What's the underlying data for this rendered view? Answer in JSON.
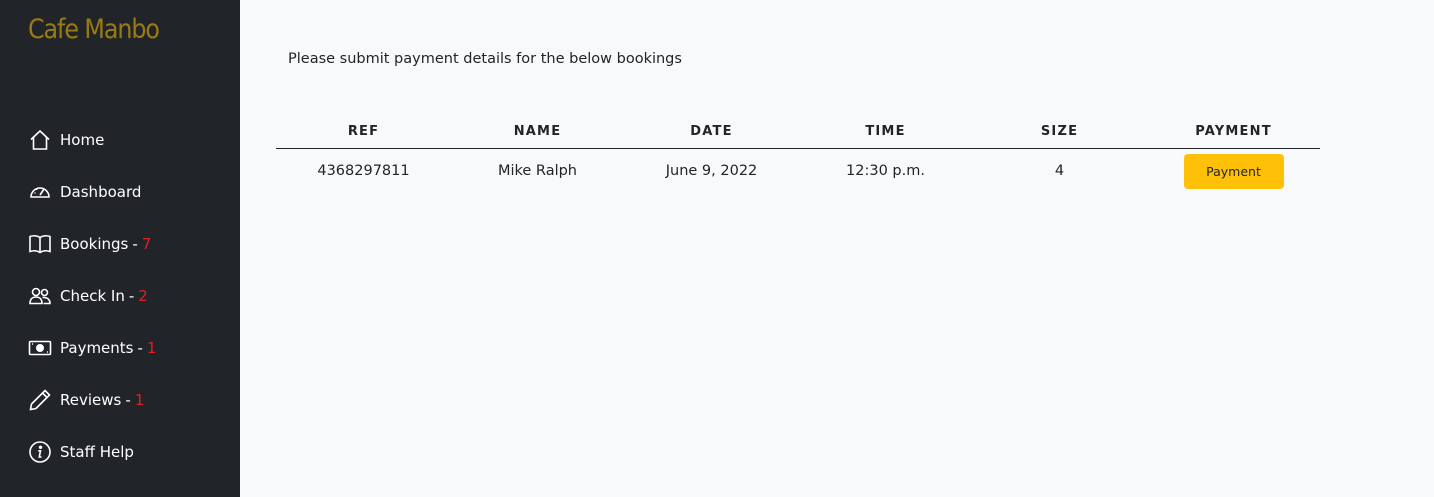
{
  "brand": "Cafe Manbo",
  "sidebar": {
    "items": [
      {
        "icon": "home-icon",
        "label": "Home",
        "sep": "",
        "count": ""
      },
      {
        "icon": "dashboard-icon",
        "label": "Dashboard",
        "sep": "",
        "count": ""
      },
      {
        "icon": "book-icon",
        "label": "Bookings",
        "sep": "-",
        "count": "7"
      },
      {
        "icon": "people-icon",
        "label": "Check In",
        "sep": "-",
        "count": "2"
      },
      {
        "icon": "cash-icon",
        "label": "Payments",
        "sep": "-",
        "count": "1"
      },
      {
        "icon": "pencil-icon",
        "label": "Reviews",
        "sep": "-",
        "count": "1"
      },
      {
        "icon": "info-icon",
        "label": "Staff Help",
        "sep": "",
        "count": ""
      }
    ]
  },
  "main": {
    "intro": "Please submit payment details for the below bookings",
    "table": {
      "headers": [
        "REF",
        "NAME",
        "DATE",
        "TIME",
        "SIZE",
        "PAYMENT"
      ],
      "rows": [
        {
          "ref": "4368297811",
          "name": "Mike Ralph",
          "date": "June 9, 2022",
          "time": "12:30 p.m.",
          "size": "4",
          "action": "Payment"
        }
      ]
    }
  },
  "colors": {
    "sidebar_bg": "#212529",
    "brand": "#9a7b12",
    "count_badge": "#e02020",
    "payment_button": "#ffc107",
    "page_bg": "#f8f9fa"
  }
}
